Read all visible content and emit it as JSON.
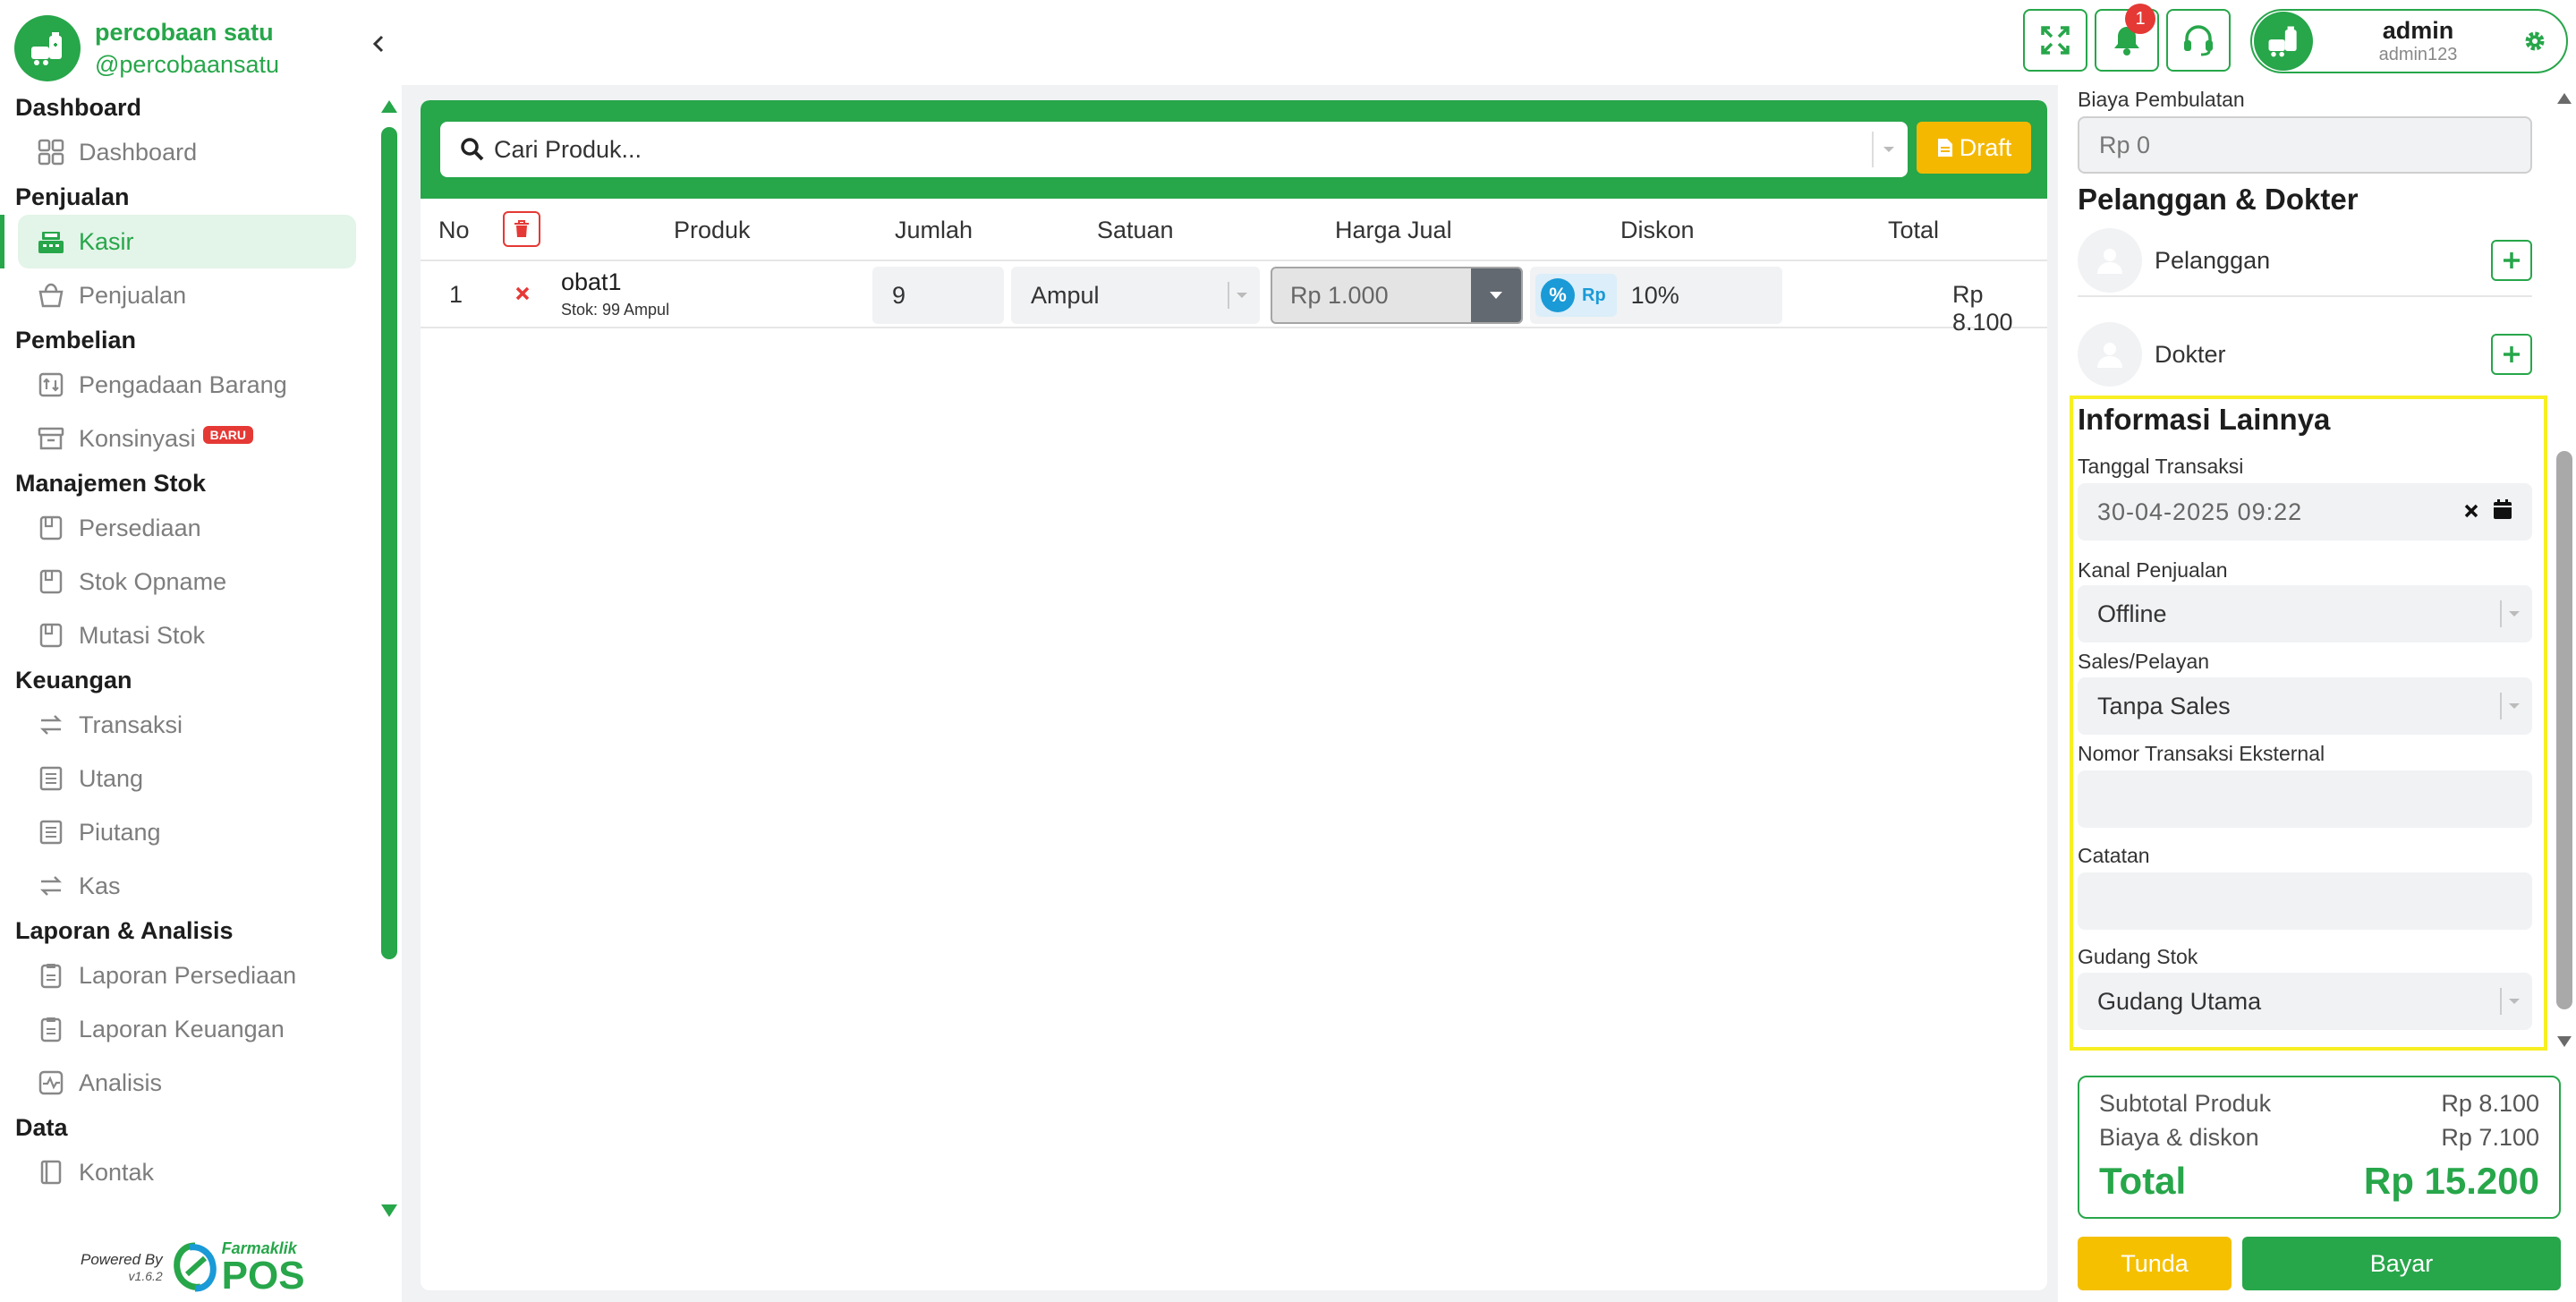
{
  "brand": {
    "name": "percobaan satu",
    "handle": "@percobaansatu"
  },
  "nav": {
    "sections": [
      {
        "title": "Dashboard",
        "items": [
          {
            "label": "Dashboard",
            "icon": "grid-icon"
          }
        ]
      },
      {
        "title": "Penjualan",
        "items": [
          {
            "label": "Kasir",
            "icon": "cash-register-icon",
            "active": true
          },
          {
            "label": "Penjualan",
            "icon": "basket-icon"
          }
        ]
      },
      {
        "title": "Pembelian",
        "items": [
          {
            "label": "Pengadaan Barang",
            "icon": "procurement-icon"
          },
          {
            "label": "Konsinyasi",
            "icon": "archive-box-icon",
            "badge": "BARU"
          }
        ]
      },
      {
        "title": "Manajemen Stok",
        "items": [
          {
            "label": "Persediaan",
            "icon": "inventory-icon"
          },
          {
            "label": "Stok Opname",
            "icon": "stock-opname-icon"
          },
          {
            "label": "Mutasi Stok",
            "icon": "stock-mutation-icon"
          }
        ]
      },
      {
        "title": "Keuangan",
        "items": [
          {
            "label": "Transaksi",
            "icon": "transfer-icon"
          },
          {
            "label": "Utang",
            "icon": "ledger-icon"
          },
          {
            "label": "Piutang",
            "icon": "ledger-icon"
          },
          {
            "label": "Kas",
            "icon": "transfer-icon"
          }
        ]
      },
      {
        "title": "Laporan & Analisis",
        "items": [
          {
            "label": "Laporan Persediaan",
            "icon": "clipboard-icon"
          },
          {
            "label": "Laporan Keuangan",
            "icon": "clipboard-icon"
          },
          {
            "label": "Analisis",
            "icon": "pulse-chart-icon"
          }
        ]
      },
      {
        "title": "Data",
        "items": [
          {
            "label": "Kontak",
            "icon": "contact-book-icon"
          }
        ]
      }
    ]
  },
  "footer": {
    "powered_by": "Powered By",
    "version": "v1.6.2",
    "brand_small": "Farmaklik",
    "brand_big": "POS"
  },
  "topbar": {
    "notif_count": "1",
    "user_name": "admin",
    "user_sub": "admin123"
  },
  "search": {
    "placeholder": "Cari Produk...",
    "draft_label": "Draft"
  },
  "table": {
    "headers": {
      "no": "No",
      "produk": "Produk",
      "jumlah": "Jumlah",
      "satuan": "Satuan",
      "harga": "Harga Jual",
      "diskon": "Diskon",
      "total": "Total"
    },
    "rows": [
      {
        "no": "1",
        "product": "obat1",
        "stock": "Stok: 99 Ampul",
        "qty": "9",
        "unit": "Ampul",
        "price": "Rp 1.000",
        "disc_pct": "%",
        "disc_rp": "Rp",
        "discount": "10%",
        "total": "Rp 8.100"
      }
    ]
  },
  "right": {
    "rounding_label": "Biaya Pembulatan",
    "rounding_value": "Rp 0",
    "cust_heading": "Pelanggan & Dokter",
    "customer": "Pelanggan",
    "doctor": "Dokter",
    "info_heading": "Informasi Lainnya",
    "date_label": "Tanggal Transaksi",
    "date_value": "30-04-2025 09:22",
    "channel_label": "Kanal Penjualan",
    "channel_value": "Offline",
    "sales_label": "Sales/Pelayan",
    "sales_value": "Tanpa Sales",
    "ext_label": "Nomor Transaksi Eksternal",
    "ext_value": "",
    "note_label": "Catatan",
    "note_value": "",
    "warehouse_label": "Gudang Stok",
    "warehouse_value": "Gudang Utama"
  },
  "summary": {
    "subtotal_label": "Subtotal Produk",
    "subtotal_value": "Rp 8.100",
    "fee_label": "Biaya & diskon",
    "fee_value": "Rp 7.100",
    "total_label": "Total",
    "total_value": "Rp 15.200"
  },
  "actions": {
    "tunda": "Tunda",
    "bayar": "Bayar"
  },
  "colors": {
    "primary": "#27a64a",
    "warning": "#f5b800",
    "danger": "#e53935",
    "highlight": "#f7ef22",
    "info": "#1a9ad6"
  }
}
